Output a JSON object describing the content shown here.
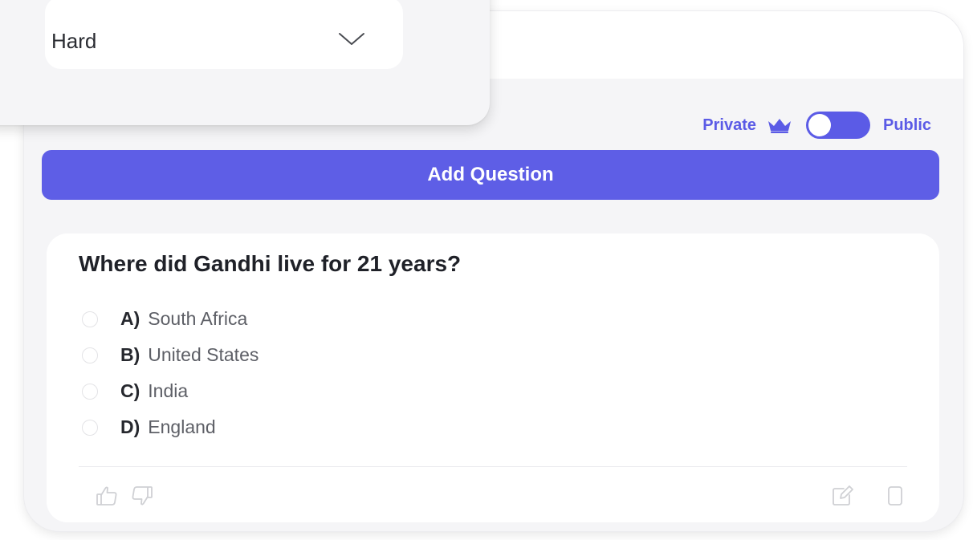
{
  "difficulty_select": {
    "value": "Hard"
  },
  "visibility": {
    "private_label": "Private",
    "public_label": "Public",
    "toggle_state": "public"
  },
  "add_question_button": {
    "label": "Add Question"
  },
  "question": {
    "title": "Where did Gandhi live for 21 years?",
    "options": [
      {
        "letter": "A)",
        "text": "South Africa"
      },
      {
        "letter": "B)",
        "text": "United States"
      },
      {
        "letter": "C)",
        "text": "India"
      },
      {
        "letter": "D)",
        "text": "England"
      }
    ]
  },
  "icons": {
    "difficulty_chevron": "chevron-down-icon",
    "premium": "crown-icon",
    "like": "thumbs-up-icon",
    "dislike": "thumbs-down-icon",
    "edit": "edit-icon",
    "delete": "trash-icon"
  },
  "colors": {
    "accent": "#5e5ee6",
    "panel_bg": "#f5f5f7",
    "card_bg": "#ffffff",
    "question_text": "#1f2128",
    "option_text": "#5d5f66"
  }
}
